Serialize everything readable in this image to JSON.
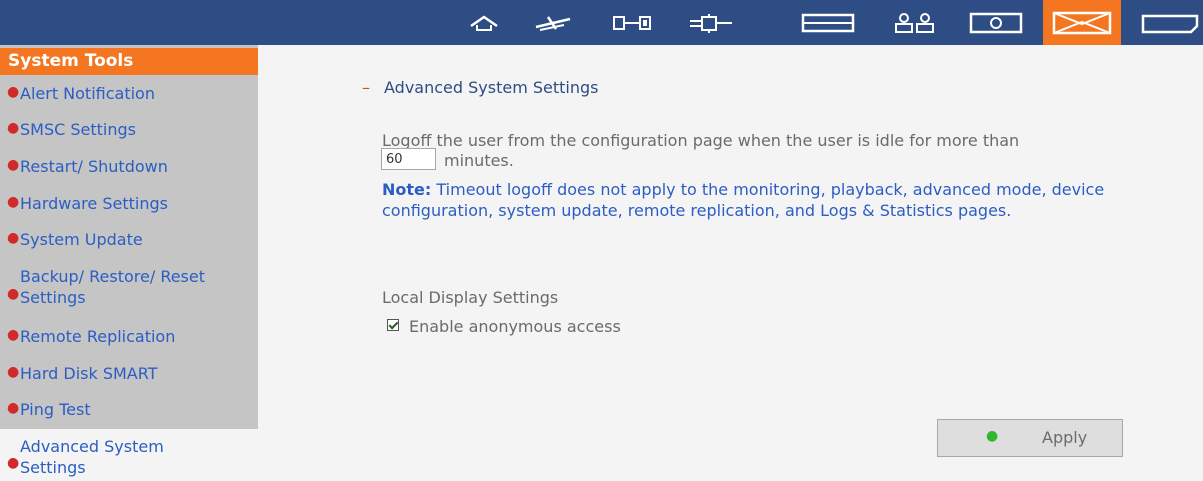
{
  "toolbar": {
    "icons": [
      "home-icon",
      "network-icon",
      "device-icon",
      "plugin-icon",
      "storage-icon",
      "users-icon",
      "monitor-icon",
      "mail-icon",
      "document-icon"
    ],
    "active_index": 7,
    "colors": {
      "bar": "#2d4d84",
      "active": "#f47621"
    }
  },
  "sidebar": {
    "title": "System Tools",
    "items": [
      {
        "label": "Alert Notification"
      },
      {
        "label": "SMSC Settings"
      },
      {
        "label": "Restart/ Shutdown"
      },
      {
        "label": "Hardware Settings"
      },
      {
        "label": "System Update"
      },
      {
        "label": "Backup/ Restore/ Reset Settings"
      },
      {
        "label": "Remote Replication"
      },
      {
        "label": "Hard Disk SMART"
      },
      {
        "label": "Ping Test"
      },
      {
        "label": "Advanced System Settings"
      }
    ],
    "selected": "Advanced System Settings"
  },
  "main": {
    "section_dash": "–",
    "section_title": "Advanced System Settings",
    "idle_text": "Logoff the user from the configuration page when the user is idle for more than",
    "idle_value": "60",
    "idle_unit": "minutes.",
    "note_label": "Note:",
    "note_text": "Timeout logoff does not apply to the monitoring, playback, advanced mode, device configuration, system update, remote replication, and Logs & Statistics pages.",
    "local_display_title": "Local Display Settings",
    "anonymous_label": "Enable anonymous access",
    "anonymous_checked": true,
    "apply_label": "Apply"
  }
}
